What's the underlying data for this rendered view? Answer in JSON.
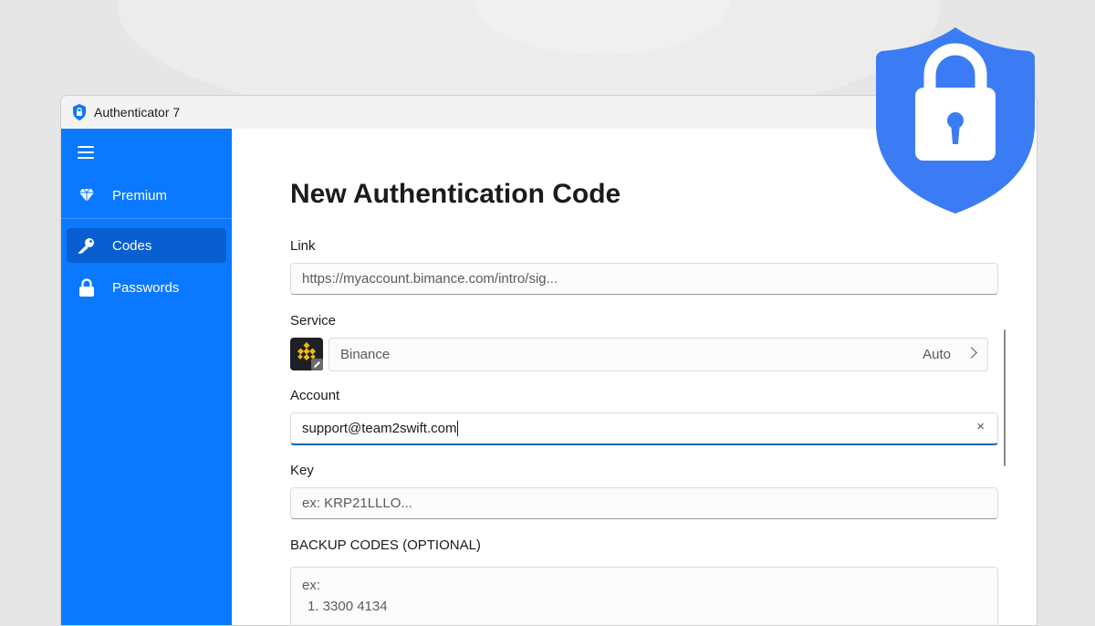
{
  "window": {
    "title": "Authenticator 7"
  },
  "sidebar": {
    "items": [
      {
        "label": "Premium",
        "icon": "diamond-icon",
        "active": false
      },
      {
        "label": "Codes",
        "icon": "key-icon",
        "active": true
      },
      {
        "label": "Passwords",
        "icon": "lock-icon",
        "active": false
      }
    ]
  },
  "form": {
    "title": "New Authentication Code",
    "link": {
      "label": "Link",
      "placeholder": "https://myaccount.bimance.com/intro/sig..."
    },
    "service": {
      "label": "Service",
      "value": "Binance",
      "mode": "Auto"
    },
    "account": {
      "label": "Account",
      "value": "support@team2swift.com",
      "clear_icon": "×"
    },
    "key": {
      "label": "Key",
      "placeholder": "ex: KRP21LLLO..."
    },
    "backup": {
      "label": "BACKUP CODES (OPTIONAL)",
      "placeholder_lines": [
        "ex:",
        "1. 3300 4134"
      ]
    }
  },
  "colors": {
    "accent": "#0b79ff",
    "active_nav": "#0a5fd0",
    "shield": "#3b7cf5"
  }
}
